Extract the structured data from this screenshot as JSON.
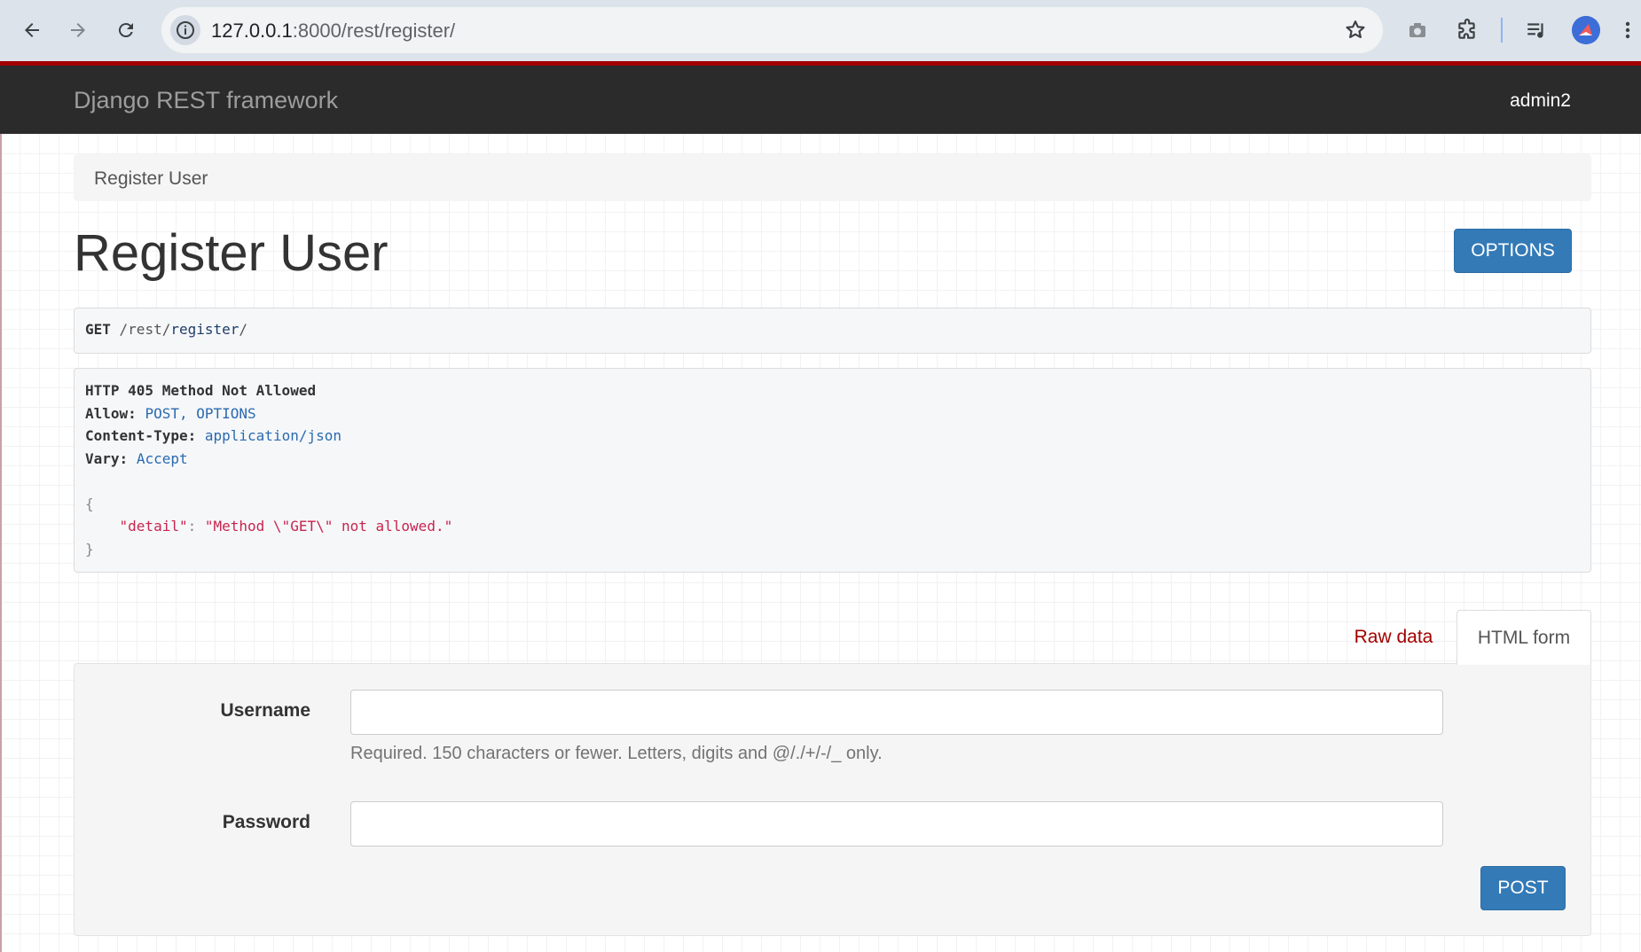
{
  "browser": {
    "url_host": "127.0.0.1",
    "url_path": ":8000/rest/register/"
  },
  "navbar": {
    "brand": "Django REST framework",
    "user": "admin2"
  },
  "breadcrumb": "Register User",
  "page_title": "Register User",
  "options_label": "OPTIONS",
  "request": {
    "method": "GET",
    "path_prefix": " /rest/",
    "path_link": "register",
    "path_suffix": "/"
  },
  "response": {
    "status": "HTTP 405 Method Not Allowed",
    "headers": [
      {
        "name": "Allow:",
        "value": "POST, OPTIONS"
      },
      {
        "name": "Content-Type:",
        "value": "application/json"
      },
      {
        "name": "Vary:",
        "value": "Accept"
      }
    ],
    "open_brace": "{",
    "body_key": "\"detail\"",
    "body_sep": ": ",
    "body_value": "\"Method \\\"GET\\\" not allowed.\"",
    "close_brace": "}"
  },
  "tabs": {
    "raw": "Raw data",
    "html": "HTML form"
  },
  "form": {
    "username_label": "Username",
    "username_value": "",
    "username_help": "Required. 150 characters or fewer. Letters, digits and @/./+/-/_ only.",
    "password_label": "Password",
    "password_value": "",
    "submit_label": "POST"
  },
  "colors": {
    "accent_red": "#a30000",
    "primary_blue": "#337ab7",
    "navbar_bg": "#2b2b2b"
  }
}
